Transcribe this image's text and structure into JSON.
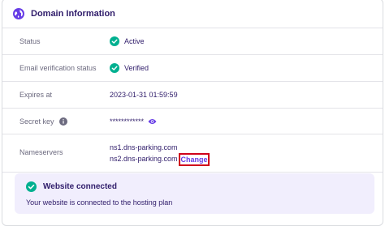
{
  "panel": {
    "title": "Domain Information",
    "icon": "globe-icon"
  },
  "rows": {
    "status": {
      "label": "Status",
      "value": "Active",
      "icon": "check-circle-icon"
    },
    "email_verification": {
      "label": "Email verification status",
      "value": "Verified",
      "icon": "check-circle-icon"
    },
    "expires": {
      "label": "Expires at",
      "value": "2023-01-31 01:59:59"
    },
    "secret_key": {
      "label": "Secret key",
      "value": "************",
      "info_icon": "info-icon",
      "reveal_icon": "eye-icon"
    },
    "nameservers": {
      "label": "Nameservers",
      "values": [
        "ns1.dns-parking.com",
        "ns2.dns-parking.com"
      ],
      "change_label": "Change"
    }
  },
  "connected": {
    "title": "Website connected",
    "description": "Your website is connected to the hosting plan",
    "icon": "check-circle-icon"
  },
  "colors": {
    "primary": "#673de6",
    "success": "#00b090",
    "text": "#2f1c6a",
    "muted": "#6c6a7f",
    "highlight_border": "#d0021b",
    "connected_bg": "#f1eefd"
  }
}
